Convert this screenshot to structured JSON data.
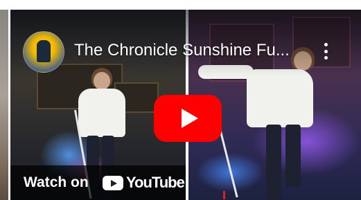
{
  "video": {
    "title": "The Chronicle Sunshine Fu...",
    "watch_on_label": "Watch on",
    "brand_name": "YouTube"
  },
  "icons": {
    "avatar": "channel-avatar",
    "menu": "more-vert-icon",
    "play": "play-icon",
    "logo": "youtube-logo-icon"
  },
  "colors": {
    "play_button": "#ff0000",
    "overlay_text": "#ffffff"
  }
}
